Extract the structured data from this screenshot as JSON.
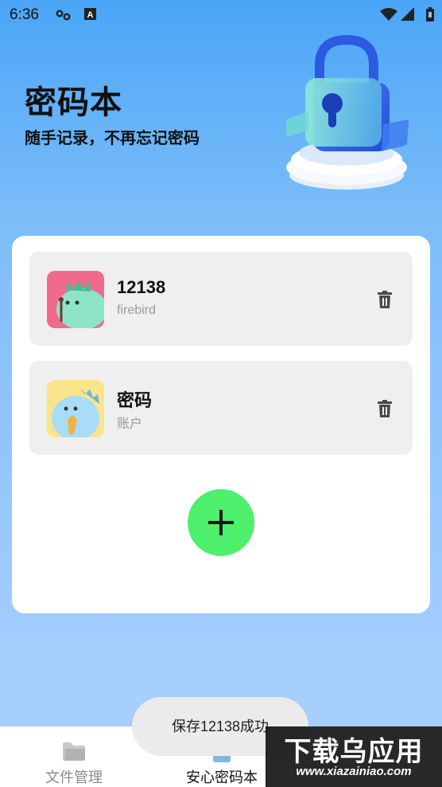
{
  "status_bar": {
    "time": "6:36",
    "icons": [
      "link-icon",
      "text-input-icon",
      "wifi-icon",
      "signal-icon",
      "battery-icon"
    ]
  },
  "header": {
    "title": "密码本",
    "subtitle": "随手记录，不再忘记密码",
    "illustration": "padlock-illustration"
  },
  "entries": [
    {
      "title": "12138",
      "subtitle": "firebird",
      "avatar": "dinosaur-avatar-pink",
      "action_icon": "trash-icon"
    },
    {
      "title": "密码",
      "subtitle": "账户",
      "avatar": "dinosaur-avatar-yellow",
      "action_icon": "trash-icon"
    }
  ],
  "add_button": {
    "icon": "plus-icon",
    "color": "#4cf06a"
  },
  "tabs": [
    {
      "label": "文件管理",
      "icon": "folder-icon",
      "active": false
    },
    {
      "label": "安心密码本",
      "icon": "lock-icon",
      "active": true
    }
  ],
  "toast": {
    "text": "保存12138成功"
  },
  "watermark": {
    "text_cn": "下载乌应用",
    "text_en": "www.xiazainiao.com"
  },
  "colors": {
    "accent": "#4cf06a",
    "background_top": "#4aa5f7",
    "card": "#ffffff",
    "entry": "#efefef"
  }
}
